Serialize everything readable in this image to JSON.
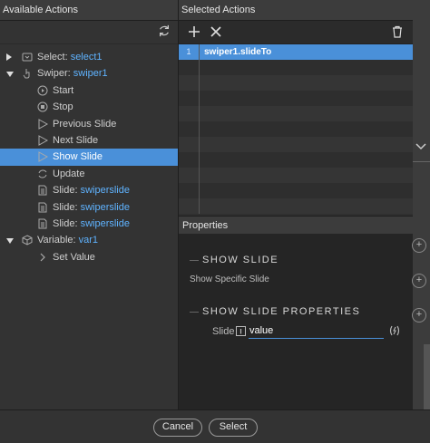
{
  "left_panel": {
    "title": "Available Actions",
    "refresh_icon": "refresh-icon",
    "tree": [
      {
        "label": "Select: ",
        "target": "select1",
        "icon": "select-icon",
        "expander": "collapsed",
        "level": 0
      },
      {
        "label": "Swiper: ",
        "target": "swiper1",
        "icon": "hand-pointer-icon",
        "expander": "expanded",
        "level": 0
      },
      {
        "label": "Start",
        "target": "",
        "icon": "play-circle-icon",
        "level": 1
      },
      {
        "label": "Stop",
        "target": "",
        "icon": "stop-circle-icon",
        "level": 1
      },
      {
        "label": "Previous Slide",
        "target": "",
        "icon": "triangle-play-icon",
        "level": 1
      },
      {
        "label": "Next Slide",
        "target": "",
        "icon": "triangle-play-icon",
        "level": 1
      },
      {
        "label": "Show Slide",
        "target": "",
        "icon": "triangle-play-icon",
        "level": 1,
        "selected": true
      },
      {
        "label": "Update",
        "target": "",
        "icon": "refresh-icon",
        "level": 1
      },
      {
        "label": "Slide: ",
        "target": "swiperslide",
        "icon": "document-icon",
        "level": 1
      },
      {
        "label": "Slide: ",
        "target": "swiperslide",
        "icon": "document-icon",
        "level": 1
      },
      {
        "label": "Slide: ",
        "target": "swiperslide",
        "icon": "document-icon",
        "level": 1
      },
      {
        "label": "Variable: ",
        "target": "var1",
        "icon": "cube-icon",
        "expander": "expanded",
        "level": 0
      },
      {
        "label": "Set Value",
        "target": "",
        "icon": "chevron-right-icon",
        "level": 1
      }
    ]
  },
  "right_panel": {
    "title": "Selected Actions",
    "toolbar": {
      "add_icon": "plus-icon",
      "remove_icon": "close-icon",
      "delete_icon": "trash-icon"
    },
    "selected_rows": [
      {
        "num": "1",
        "text": "swiper1.slideTo"
      }
    ],
    "properties": {
      "title": "Properties",
      "section1_title": "SHOW SLIDE",
      "section1_sub": "Show Specific Slide",
      "section2_title": "SHOW SLIDE PROPERTIES",
      "slide_label": "Slide",
      "slide_value": "value"
    }
  },
  "footer": {
    "cancel_label": "Cancel",
    "select_label": "Select"
  },
  "colors": {
    "accent": "#4a90d9",
    "highlight_text": "#5fb3ff"
  }
}
